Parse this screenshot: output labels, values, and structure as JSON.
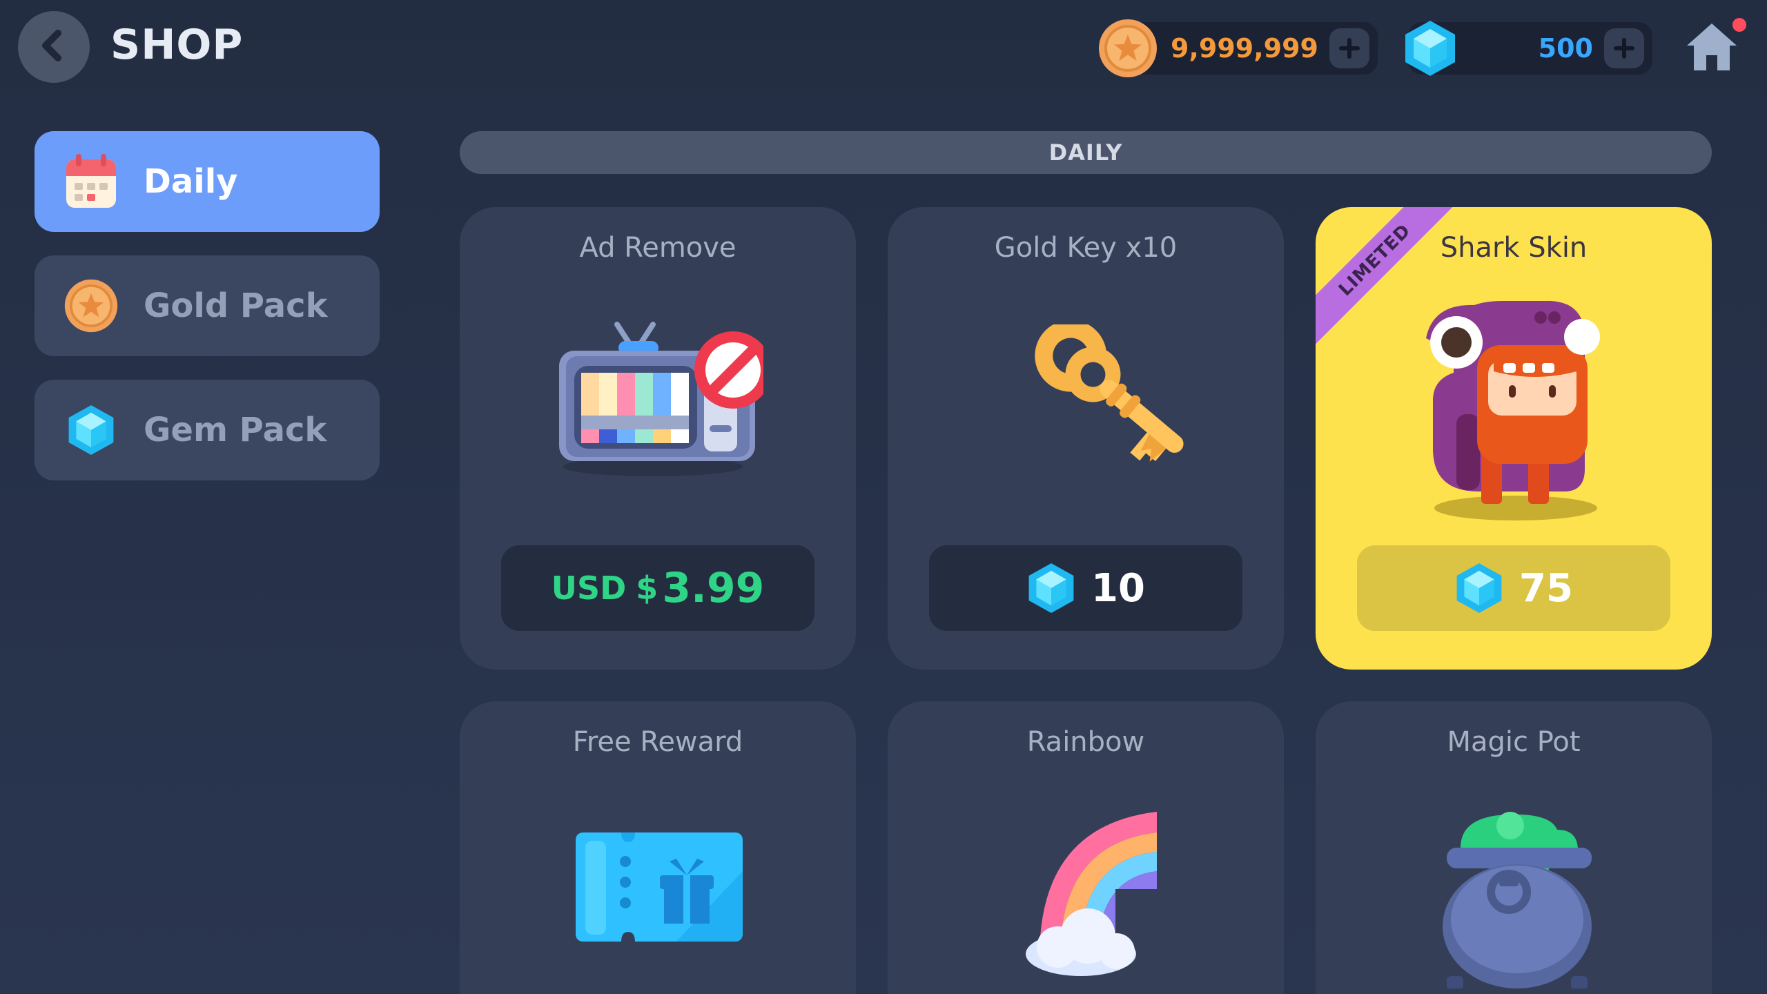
{
  "header": {
    "title": "SHOP",
    "coins": "9,999,999",
    "gems": "500"
  },
  "sidebar": {
    "items": [
      {
        "label": "Daily",
        "icon": "calendar-icon",
        "active": true
      },
      {
        "label": "Gold Pack",
        "icon": "gold-coin-icon",
        "active": false
      },
      {
        "label": "Gem Pack",
        "icon": "gem-icon",
        "active": false
      }
    ]
  },
  "section": {
    "title": "DAILY"
  },
  "cards": [
    {
      "title": "Ad Remove",
      "price_currency": "USD",
      "price_symbol": "$",
      "price": "3.99",
      "icon": "tv-no-ads-icon"
    },
    {
      "title": "Gold Key x10",
      "price": "10",
      "price_type": "gem",
      "icon": "gold-key-icon"
    },
    {
      "title": "Shark Skin",
      "price": "75",
      "price_type": "gem",
      "badge": "LIMETED",
      "icon": "shark-skin-character-icon",
      "highlight_color": "#fde24e"
    },
    {
      "title": "Free Reward",
      "icon": "ticket-gift-icon"
    },
    {
      "title": "Rainbow",
      "icon": "rainbow-icon"
    },
    {
      "title": "Magic Pot",
      "icon": "magic-pot-icon"
    }
  ],
  "colors": {
    "background": "#232d42",
    "active_tab": "#6c9dfb",
    "coin_text": "#f59a3b",
    "gem_text": "#3aa7ff",
    "usd_price": "#2fd587",
    "limited_card": "#fde24e",
    "limited_badge": "#b86de0"
  }
}
